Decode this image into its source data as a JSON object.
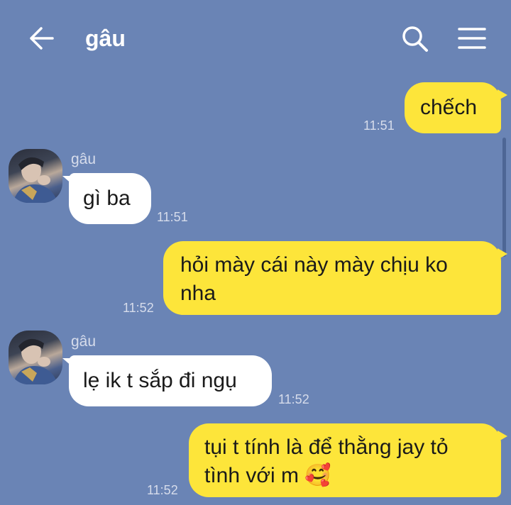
{
  "header": {
    "title": "gâu"
  },
  "icons": {
    "back": "arrow-left-icon",
    "search": "search-icon",
    "menu": "hamburger-menu-icon"
  },
  "messages": [
    {
      "direction": "outgoing",
      "text": "chếch",
      "time": "11:51"
    },
    {
      "direction": "incoming",
      "sender": "gâu",
      "text": "gì ba",
      "time": "11:51"
    },
    {
      "direction": "outgoing",
      "text": "hỏi mày cái này mày chịu ko nha",
      "line1": "hỏi mày cái này mày chịu ko",
      "line2": "nha",
      "time": "11:52"
    },
    {
      "direction": "incoming",
      "sender": "gâu",
      "text": "lẹ ik t sắp đi ngụ",
      "time": "11:52"
    },
    {
      "direction": "outgoing",
      "text": "tụi t tính là để thằng jay tỏ tình với m 🥰",
      "line1": "tụi t tính là để thằng jay tỏ",
      "line2": "tình với m 🥰",
      "time": "11:52"
    }
  ],
  "colors": {
    "background": "#6a84b5",
    "outgoing_bubble": "#fde53a",
    "incoming_bubble": "#ffffff"
  }
}
